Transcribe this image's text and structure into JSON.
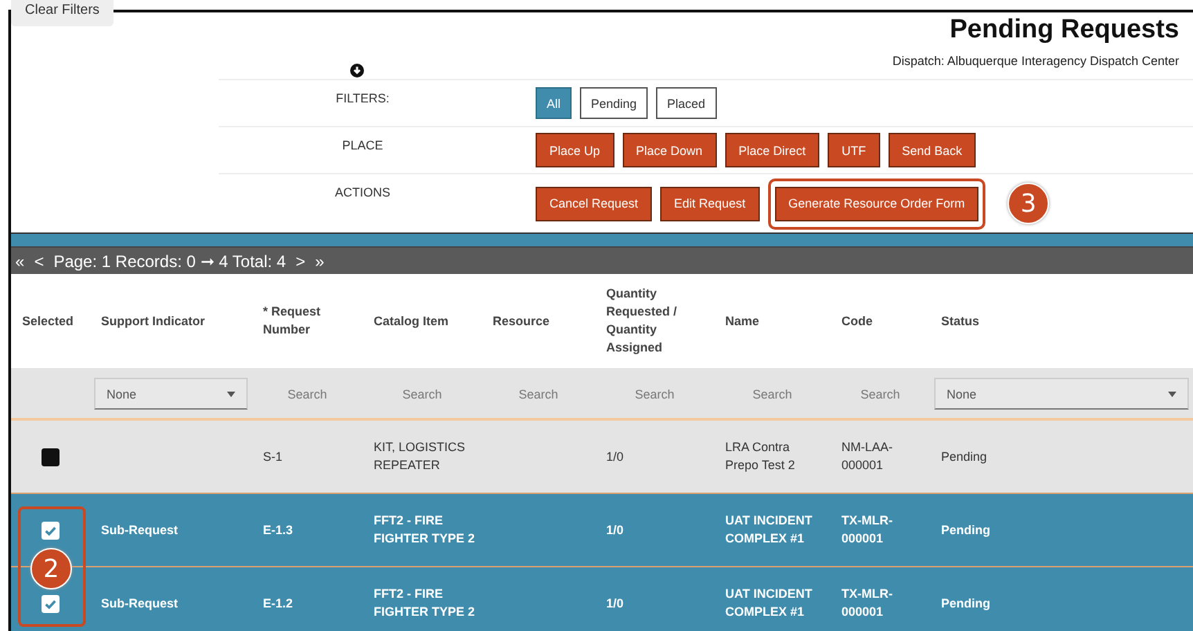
{
  "clear_filters": "Clear Filters",
  "header": {
    "title": "Pending Requests",
    "subtitle": "Dispatch: Albuquerque Interagency Dispatch Center"
  },
  "control_rows": [
    {
      "label": "FILTERS:",
      "kind": "toggle",
      "buttons": [
        {
          "label": "All",
          "selected": true
        },
        {
          "label": "Pending",
          "selected": false
        },
        {
          "label": "Placed",
          "selected": false
        }
      ]
    },
    {
      "label": "PLACE",
      "kind": "action",
      "buttons": [
        {
          "label": "Place Up"
        },
        {
          "label": "Place Down"
        },
        {
          "label": "Place Direct"
        },
        {
          "label": "UTF"
        },
        {
          "label": "Send Back"
        }
      ]
    },
    {
      "label": "ACTIONS",
      "kind": "action",
      "buttons": [
        {
          "label": "Cancel Request"
        },
        {
          "label": "Edit Request"
        },
        {
          "label": "Generate Resource Order Form",
          "highlighted": true
        }
      ],
      "callout": "3"
    }
  ],
  "pager": {
    "first": "«",
    "prev": "<",
    "text": "Page: 1 Records: 0 ➞ 4 Total: 4",
    "next": ">",
    "last": "»"
  },
  "table": {
    "columns": [
      "Selected",
      "Support Indicator",
      "* Request Number",
      "Catalog Item",
      "Resource",
      "Quantity Requested / Quantity Assigned",
      "Name",
      "Code",
      "Status"
    ],
    "filters": [
      {
        "kind": "empty"
      },
      {
        "kind": "select",
        "value": "None"
      },
      {
        "kind": "search",
        "placeholder": "Search"
      },
      {
        "kind": "search",
        "placeholder": "Search"
      },
      {
        "kind": "search",
        "placeholder": "Search"
      },
      {
        "kind": "search",
        "placeholder": "Search"
      },
      {
        "kind": "search",
        "placeholder": "Search"
      },
      {
        "kind": "search",
        "placeholder": "Search"
      },
      {
        "kind": "select",
        "value": "None"
      }
    ],
    "rows": [
      {
        "selected": false,
        "cells": [
          "",
          "",
          "S-1",
          "KIT, LOGISTICS REPEATER",
          "",
          "1/0",
          "LRA Contra Prepo Test 2",
          "NM-LAA-000001",
          "Pending"
        ]
      },
      {
        "selected": true,
        "cells": [
          "",
          "Sub-Request",
          "E-1.3",
          "FFT2 - FIRE FIGHTER TYPE 2",
          "",
          "1/0",
          "UAT INCIDENT COMPLEX #1",
          "TX-MLR-000001",
          "Pending"
        ]
      },
      {
        "selected": true,
        "cells": [
          "",
          "Sub-Request",
          "E-1.2",
          "FFT2 - FIRE FIGHTER TYPE 2",
          "",
          "1/0",
          "UAT INCIDENT COMPLEX #1",
          "TX-MLR-000001",
          "Pending"
        ]
      }
    ],
    "selection_callout": "2"
  }
}
